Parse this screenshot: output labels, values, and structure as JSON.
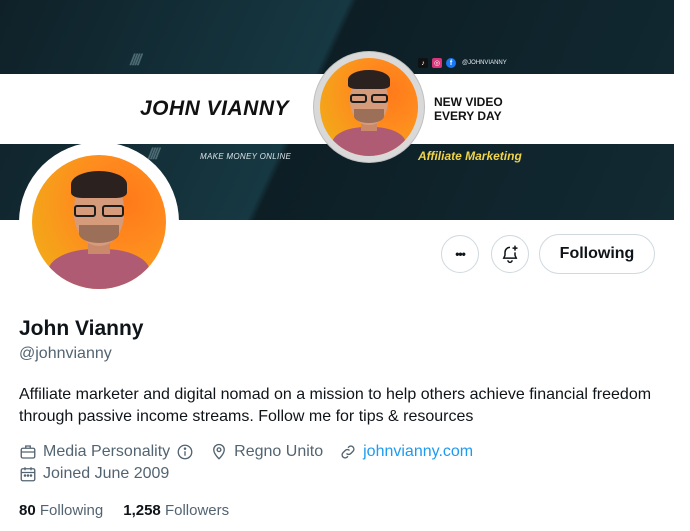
{
  "banner": {
    "name": "JOHN VIANNY",
    "tagline_line1": "NEW VIDEO",
    "tagline_line2": "EVERY DAY",
    "subtitle": "MAKE MONEY ONLINE",
    "affiliate": "Affiliate Marketing",
    "social_handle": "@JOHNVIANNY",
    "social_icons": [
      "tiktok-icon",
      "instagram-icon",
      "facebook-icon"
    ],
    "colors": {
      "dark": "#132a33",
      "accent_yellow": "#f0d44a"
    }
  },
  "profile": {
    "display_name": "John Vianny",
    "handle": "@johnvianny",
    "bio": "Affiliate marketer and digital nomad on a mission to help others achieve financial freedom through passive income streams. Follow me for tips & resources",
    "category": "Media Personality",
    "location": "Regno Unito",
    "website": "johnvianny.com",
    "joined": "Joined June 2009"
  },
  "actions": {
    "more_label": "•••",
    "following_label": "Following"
  },
  "stats": {
    "following_count": "80",
    "following_label": "Following",
    "followers_count": "1,258",
    "followers_label": "Followers"
  },
  "colors": {
    "link": "#1d9bf0",
    "secondary_text": "#536471",
    "border": "#cfd9de"
  }
}
